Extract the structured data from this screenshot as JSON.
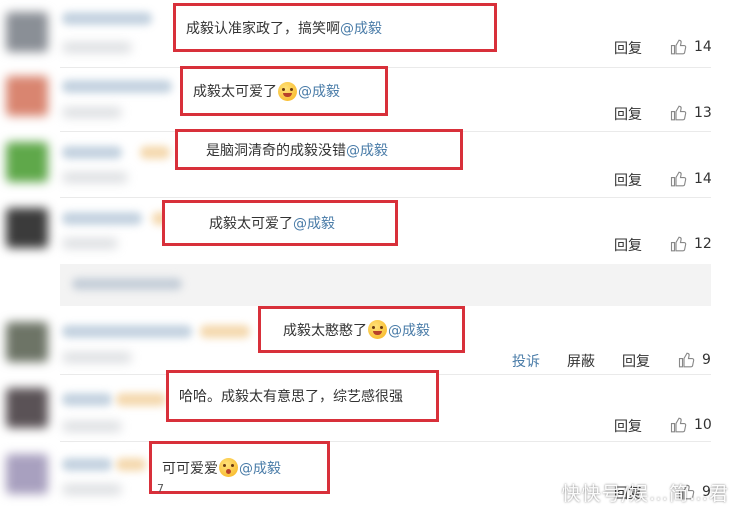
{
  "comments": [
    {
      "text": "成毅认准家政了，搞笑啊",
      "emoji": null,
      "mention": "@成毅",
      "actions": [
        "回复"
      ],
      "likes": "14"
    },
    {
      "text": "成毅太可爱了",
      "emoji": "grin-emoji",
      "mention": "@成毅",
      "actions": [
        "回复"
      ],
      "likes": "13"
    },
    {
      "text": "是脑洞清奇的成毅没错",
      "emoji": null,
      "mention": "@成毅",
      "actions": [
        "回复"
      ],
      "likes": "14"
    },
    {
      "text": "成毅太可爱了",
      "emoji": null,
      "mention": "@成毅",
      "actions": [
        "回复"
      ],
      "likes": "12"
    },
    {
      "text": "成毅太憨憨了",
      "emoji": "laugh-cry-emoji",
      "mention": "@成毅",
      "actions": [
        "投诉",
        "屏蔽",
        "回复"
      ],
      "likes": "9"
    },
    {
      "text": "哈哈。成毅太有意思了，综艺感很强",
      "emoji": null,
      "mention": "",
      "actions": [
        "回复"
      ],
      "likes": "10"
    },
    {
      "text": "可可爱爱",
      "emoji": "shocked-emoji",
      "mention": "@成毅",
      "actions": [
        "回复"
      ],
      "likes": "9"
    }
  ],
  "note": "7",
  "watermark": "快快号/娱…简…君",
  "colors": {
    "highlight_border": "#d8303a",
    "mention": "#4a7ca8",
    "text": "#333333"
  }
}
